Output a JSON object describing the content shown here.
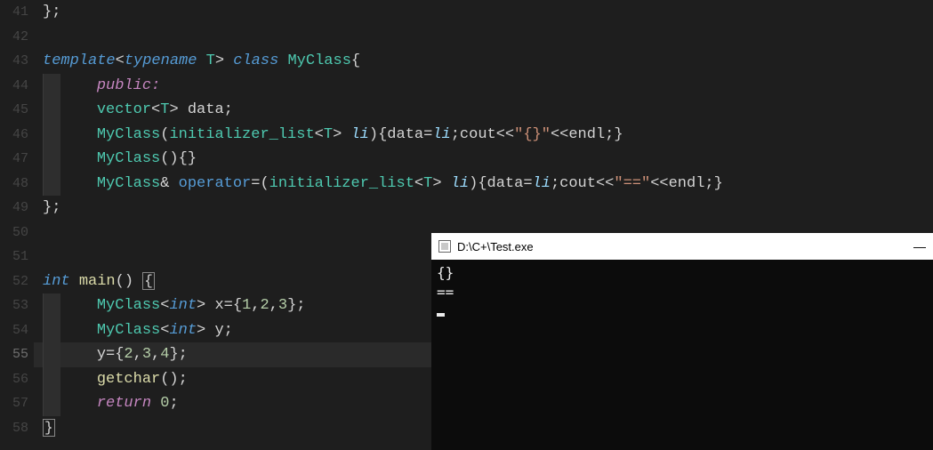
{
  "gutter": {
    "start": 41,
    "lines": [
      "41",
      "42",
      "43",
      "44",
      "45",
      "46",
      "47",
      "48",
      "49",
      "50",
      "51",
      "52",
      "53",
      "54",
      "55",
      "56",
      "57",
      "58"
    ],
    "highlighted_index": 14
  },
  "code": {
    "l41": "};",
    "template": "template",
    "typename": "typename",
    "T": "T",
    "class_kw": "class",
    "MyClass": "MyClass",
    "public_kw": "public",
    "vector": "vector",
    "data_ident": "data",
    "init_list": "initializer_list",
    "li": "li",
    "cout": "cout",
    "endl": "endl",
    "operator_kw": "operator",
    "str_braces": "\"{}\"",
    "str_eq": "\"==\"",
    "int_kw": "int",
    "main": "main",
    "x": "x",
    "y": "y",
    "n1": "1",
    "n2": "2",
    "n3": "3",
    "n4": "4",
    "n0": "0",
    "getchar": "getchar",
    "return_kw": "return"
  },
  "terminal": {
    "title": "D:\\C+\\Test.exe",
    "lines": [
      "{}",
      "=="
    ]
  }
}
